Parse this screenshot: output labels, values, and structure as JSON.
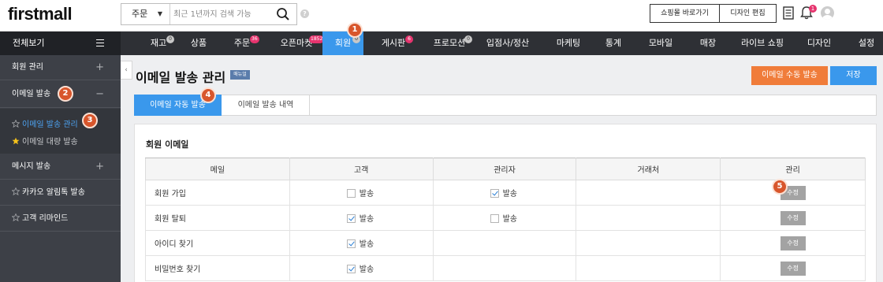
{
  "header": {
    "logo": "firstmall",
    "search_select": "주문",
    "search_placeholder": "최근 1년까지 검색 가능",
    "help": "?",
    "btn_shop": "쇼핑몰 바로가기",
    "btn_design": "디자인 편집",
    "bell_count": "1"
  },
  "nav": {
    "all_label": "전체보기",
    "items": [
      {
        "label": "재고",
        "badge": "0"
      },
      {
        "label": "상품"
      },
      {
        "label": "주문",
        "badge": "36"
      },
      {
        "label": "오픈마켓",
        "badge": "1852"
      },
      {
        "label": "회원",
        "badge": "0"
      },
      {
        "label": "게시판",
        "badge": "6"
      },
      {
        "label": "프로모션",
        "badge": "0"
      },
      {
        "label": "입점사/정산"
      },
      {
        "label": "마케팅"
      },
      {
        "label": "통계"
      },
      {
        "label": "모바일"
      },
      {
        "label": "매장"
      },
      {
        "label": "라이브 쇼핑"
      },
      {
        "label": "디자인"
      },
      {
        "label": "설정"
      }
    ]
  },
  "sidebar": {
    "member_mgmt": "회원 관리",
    "email_send": "이메일 발송",
    "email_manage": "이메일 발송 관리",
    "email_bulk": "이메일 대량 발송",
    "message_send": "메시지 발송",
    "kakao": "카카오 알림톡 발송",
    "remind": "고객 리마인드",
    "plus": "+",
    "minus": "−"
  },
  "page": {
    "title": "이메일 발송 관리",
    "manual": "매뉴얼",
    "btn_manual_send": "이메일 수동 발송",
    "btn_save": "저장"
  },
  "tabs": {
    "auto": "이메일 자동 발송",
    "history": "이메일 발송 내역"
  },
  "section": {
    "title": "회원 이메일"
  },
  "table": {
    "headers": [
      "메일",
      "고객",
      "관리자",
      "거래처",
      "관리"
    ],
    "send_label": "발송",
    "edit_label": "수정",
    "rows": [
      {
        "name": "회원 가입",
        "customer": false,
        "admin": true
      },
      {
        "name": "회원 탈퇴",
        "customer": true,
        "admin": false
      },
      {
        "name": "아이디 찾기",
        "customer": true,
        "admin": null
      },
      {
        "name": "비밀번호 찾기",
        "customer": true,
        "admin": null
      }
    ]
  },
  "markers": [
    "1",
    "2",
    "3",
    "4",
    "5"
  ],
  "colors": {
    "accent": "#3a98ec",
    "orange": "#f07c3a",
    "marker": "#d8562c"
  }
}
